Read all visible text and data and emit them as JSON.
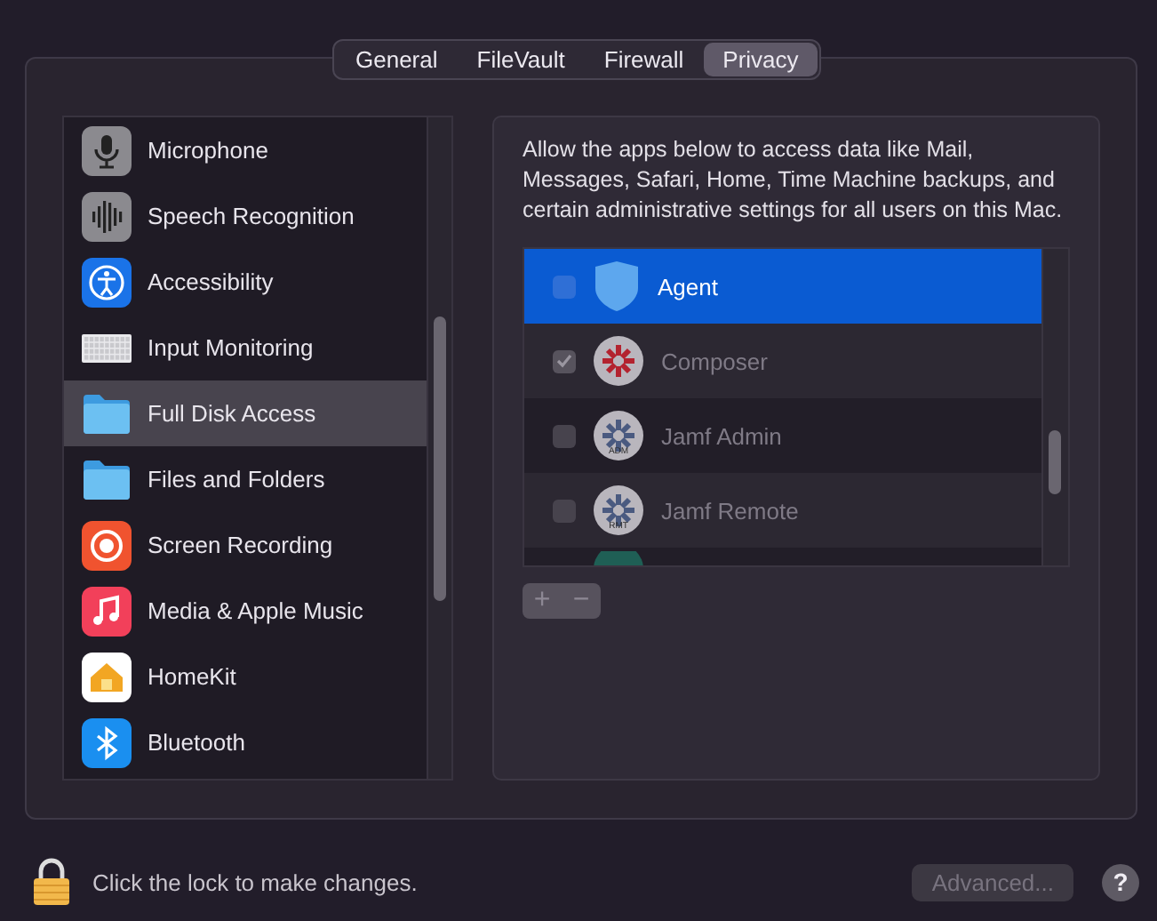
{
  "tabs": [
    {
      "label": "General",
      "selected": false
    },
    {
      "label": "FileVault",
      "selected": false
    },
    {
      "label": "Firewall",
      "selected": false
    },
    {
      "label": "Privacy",
      "selected": true
    }
  ],
  "sidebar": {
    "items": [
      {
        "label": "Microphone",
        "kind": "microphone",
        "selected": false
      },
      {
        "label": "Speech Recognition",
        "kind": "speech",
        "selected": false
      },
      {
        "label": "Accessibility",
        "kind": "accessibility",
        "selected": false
      },
      {
        "label": "Input Monitoring",
        "kind": "keyboard",
        "selected": false
      },
      {
        "label": "Full Disk Access",
        "kind": "folder",
        "selected": true
      },
      {
        "label": "Files and Folders",
        "kind": "folder",
        "selected": false
      },
      {
        "label": "Screen Recording",
        "kind": "record",
        "selected": false
      },
      {
        "label": "Media & Apple Music",
        "kind": "music",
        "selected": false
      },
      {
        "label": "HomeKit",
        "kind": "home",
        "selected": false
      },
      {
        "label": "Bluetooth",
        "kind": "bluetooth",
        "selected": false
      }
    ]
  },
  "description": "Allow the apps below to access data like Mail, Messages, Safari, Home, Time Machine backups, and certain administrative settings for all users on this Mac.",
  "apps": [
    {
      "name": "Agent",
      "kind": "shield",
      "checked": false,
      "selected": true
    },
    {
      "name": "Composer",
      "kind": "cross",
      "checked": true,
      "selected": false
    },
    {
      "name": "Jamf Admin",
      "kind": "cross",
      "badge": "ADM",
      "checked": false,
      "selected": false
    },
    {
      "name": "Jamf Remote",
      "kind": "cross",
      "badge": "RMT",
      "checked": false,
      "selected": false
    },
    {
      "kind": "disc",
      "selected": false
    }
  ],
  "list_buttons": [
    "+",
    "−"
  ],
  "footer": {
    "lock_text": "Click the lock to make changes.",
    "advanced": "Advanced...",
    "help": "?"
  }
}
